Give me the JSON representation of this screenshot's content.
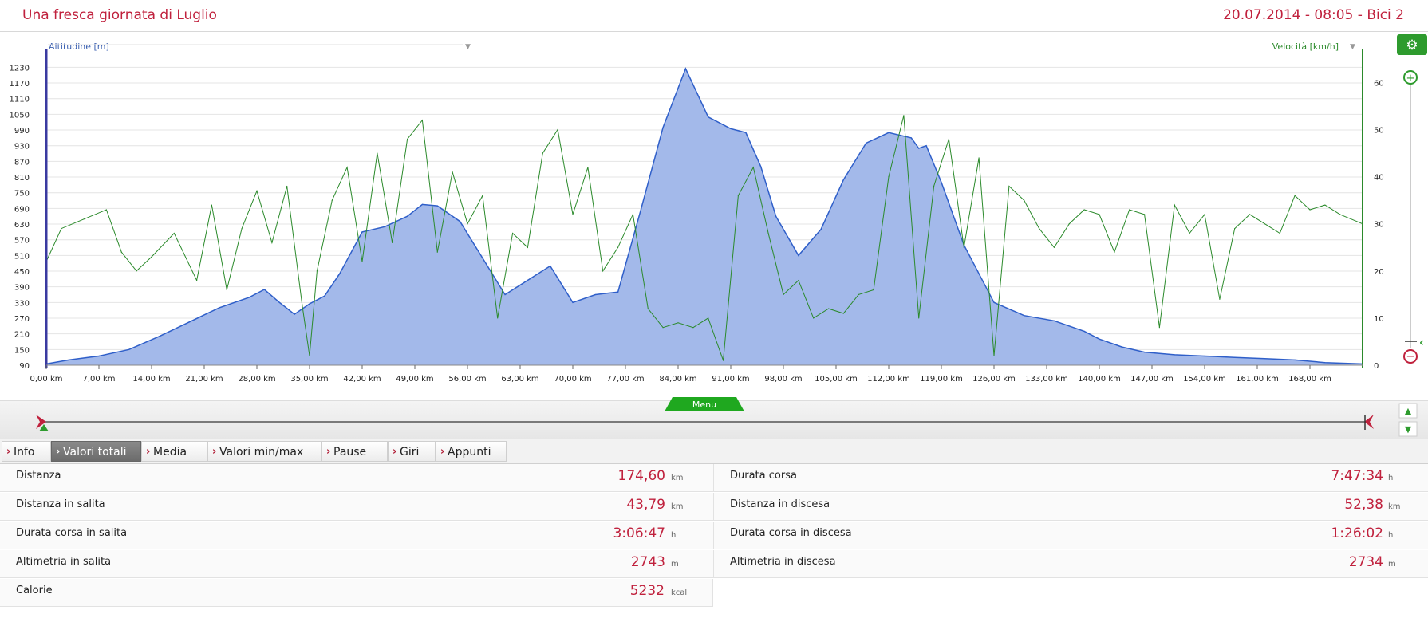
{
  "header": {
    "title": "Una fresca giornata di Luglio",
    "info": "20.07.2014 - 08:05 - Bici 2"
  },
  "chart": {
    "left_axis_label": "Altitudine [m]",
    "right_axis_label": "Velocità [km/h]",
    "menu_label": "Menu",
    "colors": {
      "altitude_fill": "#a3b9ea",
      "altitude_line": "#2f5fc9",
      "speed_line": "#2b8a2b",
      "left_axis": "#3a3aa0",
      "right_axis": "#2b8a2b"
    }
  },
  "chart_data": {
    "type": "area",
    "series": [
      {
        "name": "Altitudine [m]",
        "axis": "left",
        "x": [
          0,
          3,
          7,
          11,
          15,
          19,
          23,
          27,
          29,
          31,
          33,
          35,
          37,
          39,
          42,
          45,
          48,
          50,
          52,
          55,
          58,
          61,
          64,
          67,
          70,
          73,
          76,
          79,
          82,
          85,
          88,
          91,
          93,
          95,
          97,
          100,
          103,
          106,
          109,
          112,
          115,
          116,
          117,
          119,
          122,
          126,
          130,
          134,
          138,
          140,
          143,
          146,
          150,
          154,
          158,
          162,
          166,
          170,
          175
        ],
        "y": [
          95,
          110,
          125,
          150,
          200,
          255,
          310,
          350,
          380,
          330,
          285,
          325,
          355,
          440,
          600,
          620,
          660,
          705,
          700,
          640,
          500,
          360,
          415,
          470,
          330,
          360,
          370,
          680,
          1000,
          1225,
          1040,
          995,
          980,
          850,
          660,
          510,
          610,
          800,
          940,
          980,
          960,
          920,
          930,
          790,
          550,
          330,
          280,
          260,
          220,
          190,
          160,
          140,
          130,
          125,
          120,
          115,
          110,
          100,
          95
        ]
      },
      {
        "name": "Velocità [km/h]",
        "axis": "right",
        "x": [
          0,
          2,
          5,
          8,
          10,
          12,
          14,
          17,
          20,
          22,
          24,
          26,
          28,
          30,
          32,
          34,
          35,
          36,
          38,
          40,
          42,
          44,
          46,
          48,
          50,
          52,
          54,
          56,
          58,
          60,
          62,
          64,
          66,
          68,
          70,
          72,
          74,
          76,
          78,
          80,
          82,
          84,
          86,
          88,
          90,
          92,
          94,
          96,
          98,
          100,
          102,
          104,
          106,
          108,
          110,
          112,
          114,
          116,
          118,
          120,
          122,
          124,
          126,
          128,
          130,
          132,
          134,
          136,
          138,
          140,
          142,
          144,
          146,
          148,
          150,
          152,
          154,
          156,
          158,
          160,
          162,
          164,
          166,
          168,
          170,
          172,
          175
        ],
        "y": [
          22,
          29,
          31,
          33,
          24,
          20,
          23,
          28,
          18,
          34,
          16,
          29,
          37,
          26,
          38,
          13,
          2,
          20,
          35,
          42,
          22,
          45,
          26,
          48,
          52,
          24,
          41,
          30,
          36,
          10,
          28,
          25,
          45,
          50,
          32,
          42,
          20,
          25,
          32,
          12,
          8,
          9,
          8,
          10,
          1,
          36,
          42,
          28,
          15,
          18,
          10,
          12,
          11,
          15,
          16,
          40,
          53,
          10,
          38,
          48,
          25,
          44,
          2,
          38,
          35,
          29,
          25,
          30,
          33,
          32,
          24,
          33,
          32,
          8,
          34,
          28,
          32,
          14,
          29,
          32,
          30,
          28,
          36,
          33,
          34,
          32,
          30
        ]
      }
    ],
    "x_ticks": [
      "0,00 km",
      "7,00 km",
      "14,00 km",
      "21,00 km",
      "28,00 km",
      "35,00 km",
      "42,00 km",
      "49,00 km",
      "56,00 km",
      "63,00 km",
      "70,00 km",
      "77,00 km",
      "84,00 km",
      "91,00 km",
      "98,00 km",
      "105,00 km",
      "112,00 km",
      "119,00 km",
      "126,00 km",
      "133,00 km",
      "140,00 km",
      "147,00 km",
      "154,00 km",
      "161,00 km",
      "168,00 km"
    ],
    "x_tick_values": [
      0,
      7,
      14,
      21,
      28,
      35,
      42,
      49,
      56,
      63,
      70,
      77,
      84,
      91,
      98,
      105,
      112,
      119,
      126,
      133,
      140,
      147,
      154,
      161,
      168
    ],
    "left_ticks": [
      "1230",
      "1170",
      "1110",
      "1050",
      "990",
      "930",
      "870",
      "810",
      "750",
      "690",
      "630",
      "570",
      "510",
      "450",
      "390",
      "330",
      "270",
      "210",
      "150",
      "90"
    ],
    "left_tick_values": [
      1230,
      1170,
      1110,
      1050,
      990,
      930,
      870,
      810,
      750,
      690,
      630,
      570,
      510,
      450,
      390,
      330,
      270,
      210,
      150,
      90
    ],
    "right_ticks": [
      "60",
      "50",
      "40",
      "30",
      "20",
      "10",
      "0"
    ],
    "right_tick_values": [
      60,
      50,
      40,
      30,
      20,
      10,
      0
    ],
    "xlim": [
      0,
      175
    ],
    "ylim_left": [
      90,
      1280
    ],
    "ylim_right": [
      0,
      66
    ],
    "grid": true
  },
  "tabs": [
    {
      "label": "Info",
      "active": false
    },
    {
      "label": "Valori totali",
      "active": true
    },
    {
      "label": "Media",
      "active": false
    },
    {
      "label": "Valori min/max",
      "active": false
    },
    {
      "label": "Pause",
      "active": false
    },
    {
      "label": "Giri",
      "active": false
    },
    {
      "label": "Appunti",
      "active": false
    }
  ],
  "stats": {
    "left": [
      {
        "label": "Distanza",
        "value": "174,60",
        "unit": "km"
      },
      {
        "label": "Distanza in salita",
        "value": "43,79",
        "unit": "km"
      },
      {
        "label": "Durata corsa in salita",
        "value": "3:06:47",
        "unit": "h"
      },
      {
        "label": "Altimetria in salita",
        "value": "2743",
        "unit": "m"
      },
      {
        "label": "Calorie",
        "value": "5232",
        "unit": "kcal"
      }
    ],
    "right": [
      {
        "label": "Durata corsa",
        "value": "7:47:34",
        "unit": "h"
      },
      {
        "label": "Distanza in discesa",
        "value": "52,38",
        "unit": "km"
      },
      {
        "label": "Durata corsa in discesa",
        "value": "1:26:02",
        "unit": "h"
      },
      {
        "label": "Altimetria in discesa",
        "value": "2734",
        "unit": "m"
      }
    ]
  }
}
